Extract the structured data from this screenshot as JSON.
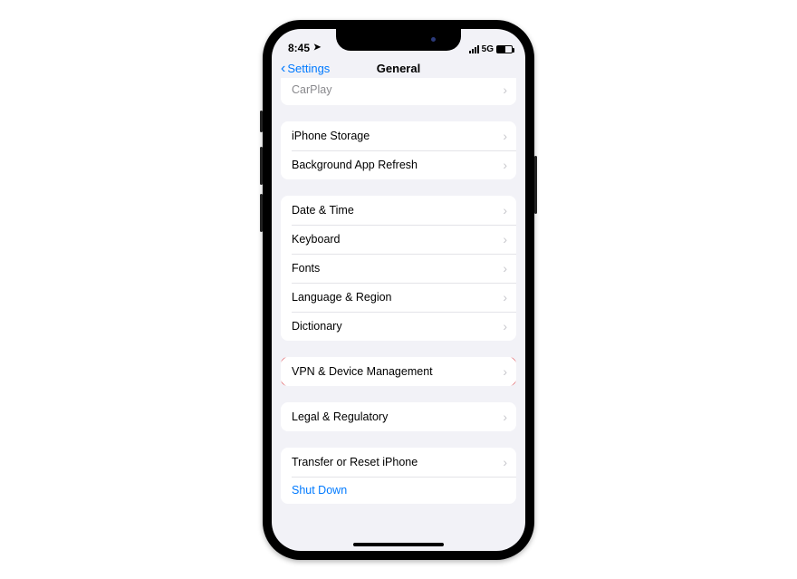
{
  "statusbar": {
    "time": "8:45",
    "network": "5G"
  },
  "navbar": {
    "back": "Settings",
    "title": "General"
  },
  "groups": {
    "g0": {
      "carplay": "CarPlay"
    },
    "g1": {
      "storage": "iPhone Storage",
      "refresh": "Background App Refresh"
    },
    "g2": {
      "datetime": "Date & Time",
      "keyboard": "Keyboard",
      "fonts": "Fonts",
      "language": "Language & Region",
      "dictionary": "Dictionary"
    },
    "g3": {
      "vpn": "VPN & Device Management"
    },
    "g4": {
      "legal": "Legal & Regulatory"
    },
    "g5": {
      "transfer": "Transfer or Reset iPhone",
      "shutdown": "Shut Down"
    }
  }
}
